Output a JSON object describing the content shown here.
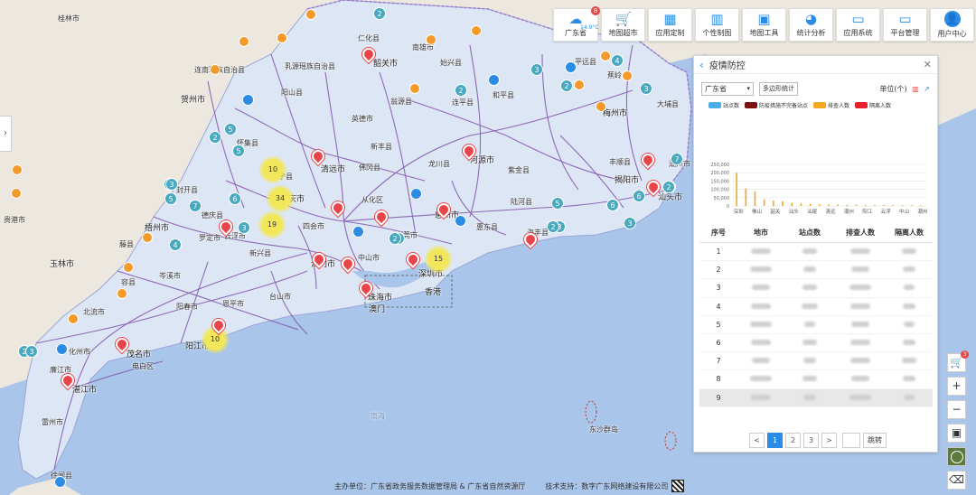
{
  "toolbar": {
    "weather": {
      "label": "广东省",
      "temp": "14.9°C",
      "badge": "8"
    },
    "items": [
      {
        "label": "地图超市",
        "icon": "cart-icon"
      },
      {
        "label": "应用定制",
        "icon": "grid-icon"
      },
      {
        "label": "个性制图",
        "icon": "map-book-icon"
      },
      {
        "label": "地图工具",
        "icon": "toolbox-icon"
      },
      {
        "label": "统计分析",
        "icon": "pie-chart-icon"
      },
      {
        "label": "应用系统",
        "icon": "monitor-settings-icon"
      },
      {
        "label": "平台管理",
        "icon": "monitor-icon"
      },
      {
        "label": "用户中心",
        "icon": "user-avatar-icon"
      }
    ]
  },
  "map": {
    "places": [
      "桂林市",
      "连南瑶族自治县",
      "贺州市",
      "阳山县",
      "乳源瑶族自治县",
      "仁化县",
      "南雄市",
      "韶关市",
      "始兴县",
      "翁源县",
      "新丰县",
      "英德市",
      "佛冈县",
      "清远市",
      "从化区",
      "河源市",
      "龙川县",
      "和平县",
      "连平县",
      "平远县",
      "蕉岭县",
      "大埔县",
      "梅州市",
      "丰顺县",
      "揭阳市",
      "潮州市",
      "汕头市",
      "紫金县",
      "陆河县",
      "惠东县",
      "海丰县",
      "惠州市",
      "东莞市",
      "深圳市",
      "香港",
      "珠海市",
      "澳门",
      "中山市",
      "江门市",
      "台山市",
      "恩平市",
      "阳春市",
      "阳江市",
      "电白区",
      "茂名市",
      "化州市",
      "湛江市",
      "廉江市",
      "雷州市",
      "徐闻县",
      "云浮市",
      "罗定市",
      "新兴县",
      "肇庆市",
      "德庆县",
      "封开县",
      "怀集县",
      "广宁县",
      "四会市",
      "梧州市",
      "玉林市",
      "贵港市",
      "北流市",
      "容县",
      "藤县",
      "岑溪市",
      "东沙群岛",
      "南海"
    ],
    "clusters": [
      "2",
      "2",
      "5",
      "4",
      "2",
      "3",
      "3",
      "2",
      "3",
      "5",
      "2",
      "5",
      "4",
      "7",
      "3",
      "6",
      "3",
      "3",
      "5",
      "3",
      "2",
      "5",
      "6",
      "2",
      "3",
      "7",
      "3",
      "6",
      "2",
      "2"
    ],
    "big_clusters": [
      "10",
      "34",
      "19",
      "10",
      "15"
    ]
  },
  "side_toggle": "›",
  "panel": {
    "title": "疫情防控",
    "province_select": "广东省",
    "polygon_button": "多边形统计",
    "unit_label": "单位(个)",
    "legend": [
      {
        "label": "站点数",
        "color": "#4eaee8"
      },
      {
        "label": "防疫措施不完备站点",
        "color": "#7a1010"
      },
      {
        "label": "排查人数",
        "color": "#f5a623"
      },
      {
        "label": "隔离人数",
        "color": "#e8202a"
      }
    ],
    "table": {
      "headers": [
        "序号",
        "地市",
        "站点数",
        "排查人数",
        "隔离人数"
      ],
      "rows": [
        "1",
        "2",
        "3",
        "4",
        "5",
        "6",
        "7",
        "8",
        "9"
      ]
    },
    "pager": {
      "prev": "<",
      "pages": [
        "1",
        "2",
        "3"
      ],
      "next": ">",
      "jump": "跳转"
    }
  },
  "chart_data": {
    "type": "bar",
    "categories": [
      "深圳",
      "佛山",
      "韶关",
      "汕头",
      "汕尾",
      "清远",
      "潮州",
      "阳江",
      "云浮",
      "中山",
      "潮州"
    ],
    "series": [
      {
        "name": "排查人数",
        "values": [
          200000,
          105000,
          88000,
          40000,
          32000,
          28000,
          18000,
          15000,
          12000,
          10000,
          9000,
          8000,
          7000,
          7000,
          6000,
          5500,
          5000,
          5000,
          4500,
          4000,
          3000
        ]
      }
    ],
    "ylim": [
      0,
      250000
    ],
    "yticks": [
      "0",
      "50,000",
      "100,000",
      "150,000",
      "200,000",
      "250,000"
    ]
  },
  "right_controls": {
    "cart_badge": "3"
  },
  "footer": {
    "host": "主办单位：广东省政务服务数据管理局 & 广东省自然资源厅",
    "support": "技术支持：数字广东网络建设有限公司"
  }
}
